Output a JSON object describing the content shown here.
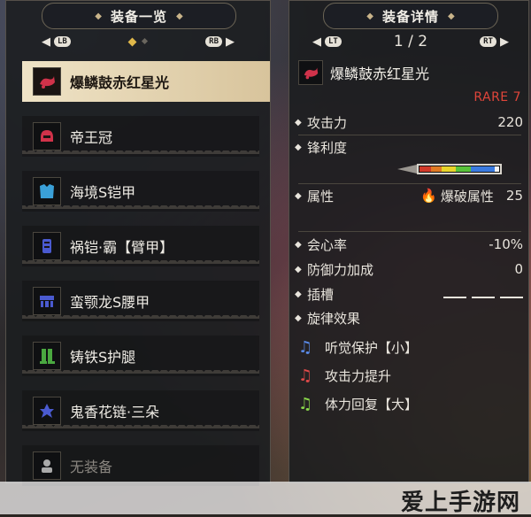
{
  "left_panel": {
    "title": "装备一览",
    "nav": {
      "left_button": "LB",
      "right_button": "RB",
      "left_arrow": "◀",
      "right_arrow": "▶"
    },
    "items": [
      {
        "label": "爆鳞鼓赤红星光",
        "icon": "horn-weapon-icon",
        "icon_color": "#d0324a",
        "selected": true
      },
      {
        "label": "帝王冠",
        "icon": "helmet-icon",
        "icon_color": "#d0324a"
      },
      {
        "label": "海境S铠甲",
        "icon": "chest-armor-icon",
        "icon_color": "#3aa0d8"
      },
      {
        "label": "祸铠·霸【臂甲】",
        "icon": "arm-armor-icon",
        "icon_color": "#4a5ad0"
      },
      {
        "label": "蛮颚龙S腰甲",
        "icon": "waist-armor-icon",
        "icon_color": "#4a5ad0"
      },
      {
        "label": "铸铁S护腿",
        "icon": "leg-armor-icon",
        "icon_color": "#4aa840"
      },
      {
        "label": "鬼香花链·三朵",
        "icon": "charm-icon",
        "icon_color": "#4a5ad0"
      },
      {
        "label": "无装备",
        "icon": "empty-slot-icon",
        "icon_color": "#aaaaaa",
        "empty": true
      }
    ]
  },
  "right_panel": {
    "title": "装备详情",
    "nav": {
      "left_button": "LT",
      "right_button": "RT",
      "left_arrow": "◀",
      "right_arrow": "▶",
      "page": "1 / 2"
    },
    "weapon_name": "爆鳞鼓赤红星光",
    "rarity": "RARE 7",
    "stats": {
      "attack_label": "攻击力",
      "attack_value": "220",
      "sharpness_label": "锋利度",
      "element_label": "属性",
      "element_name": "爆破属性",
      "element_value": "25",
      "affinity_label": "会心率",
      "affinity_value": "-10%",
      "defense_label": "防御力加成",
      "defense_value": "0",
      "slots_label": "插槽",
      "melody_label": "旋律效果"
    },
    "sharpness": [
      {
        "color": "#d23a2a",
        "fraction": 0.14
      },
      {
        "color": "#e07a24",
        "fraction": 0.14
      },
      {
        "color": "#e8d42a",
        "fraction": 0.18
      },
      {
        "color": "#58c23a",
        "fraction": 0.18
      },
      {
        "color": "#3a7ae0",
        "fraction": 0.3
      },
      {
        "color": "#f2f2f2",
        "fraction": 0.06
      }
    ],
    "melodies": [
      {
        "label": "听觉保护【小】",
        "note_color": "#5a8ae8"
      },
      {
        "label": "攻击力提升",
        "note_color": "#e04a4a"
      },
      {
        "label": "体力回复【大】",
        "note_color": "#8ad84a"
      }
    ]
  },
  "watermark": "爱上手游网"
}
